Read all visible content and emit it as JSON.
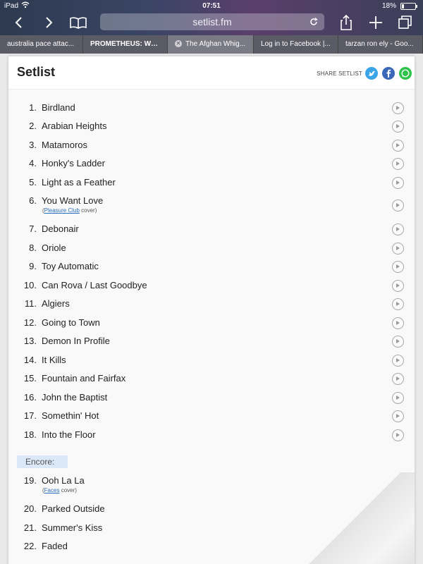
{
  "status": {
    "device": "iPad",
    "time": "07:51",
    "battery": "18%"
  },
  "browser": {
    "address": "setlist.fm",
    "tabs": [
      {
        "label": "australia pace attac..."
      },
      {
        "label": "PROMETHEUS: Wor..."
      },
      {
        "label": "The Afghan Whig..."
      },
      {
        "label": "Log in to Facebook |..."
      },
      {
        "label": "tarzan ron ely - Goo..."
      }
    ]
  },
  "page": {
    "title": "Setlist",
    "share_label": "SHARE SETLIST",
    "share_icons": [
      "twitter-icon",
      "facebook-icon",
      "whatsapp-icon"
    ],
    "encore_label": "Encore:"
  },
  "songs": [
    {
      "num": "1.",
      "name": "Birdland"
    },
    {
      "num": "2.",
      "name": "Arabian Heights"
    },
    {
      "num": "3.",
      "name": "Matamoros"
    },
    {
      "num": "4.",
      "name": "Honky's Ladder"
    },
    {
      "num": "5.",
      "name": "Light as a Feather"
    },
    {
      "num": "6.",
      "name": "You Want Love",
      "cover_open": "(",
      "cover_link": "Pleasure Club",
      "cover_close": " cover)"
    },
    {
      "num": "7.",
      "name": "Debonair"
    },
    {
      "num": "8.",
      "name": "Oriole"
    },
    {
      "num": "9.",
      "name": "Toy Automatic"
    },
    {
      "num": "10.",
      "name": "Can Rova / Last Goodbye"
    },
    {
      "num": "11.",
      "name": "Algiers"
    },
    {
      "num": "12.",
      "name": "Going to Town"
    },
    {
      "num": "13.",
      "name": "Demon In Profile"
    },
    {
      "num": "14.",
      "name": "It Kills"
    },
    {
      "num": "15.",
      "name": "Fountain and Fairfax"
    },
    {
      "num": "16.",
      "name": "John the Baptist"
    },
    {
      "num": "17.",
      "name": "Somethin' Hot"
    },
    {
      "num": "18.",
      "name": "Into the Floor"
    }
  ],
  "encore": [
    {
      "num": "19.",
      "name": "Ooh La La",
      "cover_open": "(",
      "cover_link": "Faces",
      "cover_close": " cover)"
    },
    {
      "num": "20.",
      "name": "Parked Outside"
    },
    {
      "num": "21.",
      "name": "Summer's Kiss"
    },
    {
      "num": "22.",
      "name": "Faded"
    }
  ]
}
